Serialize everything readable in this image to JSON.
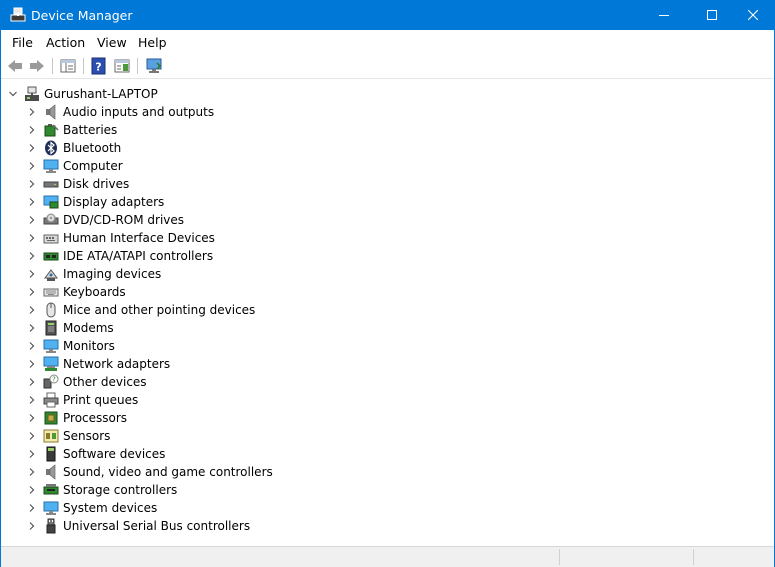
{
  "window": {
    "title": "Device Manager"
  },
  "menu": [
    {
      "label": "File",
      "name": "menu-file"
    },
    {
      "label": "Action",
      "name": "menu-action"
    },
    {
      "label": "View",
      "name": "menu-view"
    },
    {
      "label": "Help",
      "name": "menu-help"
    }
  ],
  "toolbar": [
    {
      "name": "back-button",
      "icon": "back-arrow-icon"
    },
    {
      "name": "forward-button",
      "icon": "forward-arrow-icon"
    },
    {
      "name": "show-hide-console-tree-button",
      "icon": "console-tree-icon"
    },
    {
      "name": "help-button",
      "icon": "help-icon"
    },
    {
      "name": "properties-button",
      "icon": "properties-pane-icon"
    },
    {
      "name": "scan-hardware-changes-button",
      "icon": "monitor-scan-icon"
    }
  ],
  "tree": {
    "root": {
      "label": "Gurushant-LAPTOP",
      "expanded": true,
      "icon": "computer-tree-icon"
    },
    "categories": [
      {
        "label": "Audio inputs and outputs",
        "icon": "speaker-icon"
      },
      {
        "label": "Batteries",
        "icon": "battery-icon"
      },
      {
        "label": "Bluetooth",
        "icon": "bluetooth-icon"
      },
      {
        "label": "Computer",
        "icon": "computer-icon"
      },
      {
        "label": "Disk drives",
        "icon": "disk-drive-icon"
      },
      {
        "label": "Display adapters",
        "icon": "display-adapter-icon"
      },
      {
        "label": "DVD/CD-ROM drives",
        "icon": "dvd-drive-icon"
      },
      {
        "label": "Human Interface Devices",
        "icon": "hid-icon"
      },
      {
        "label": "IDE ATA/ATAPI controllers",
        "icon": "ide-controller-icon"
      },
      {
        "label": "Imaging devices",
        "icon": "camera-icon"
      },
      {
        "label": "Keyboards",
        "icon": "keyboard-icon"
      },
      {
        "label": "Mice and other pointing devices",
        "icon": "mouse-icon"
      },
      {
        "label": "Modems",
        "icon": "modem-icon"
      },
      {
        "label": "Monitors",
        "icon": "monitor-icon"
      },
      {
        "label": "Network adapters",
        "icon": "network-adapter-icon"
      },
      {
        "label": "Other devices",
        "icon": "unknown-device-icon"
      },
      {
        "label": "Print queues",
        "icon": "printer-icon"
      },
      {
        "label": "Processors",
        "icon": "processor-icon"
      },
      {
        "label": "Sensors",
        "icon": "sensor-icon"
      },
      {
        "label": "Software devices",
        "icon": "software-device-icon"
      },
      {
        "label": "Sound, video and game controllers",
        "icon": "sound-controller-icon"
      },
      {
        "label": "Storage controllers",
        "icon": "storage-controller-icon"
      },
      {
        "label": "System devices",
        "icon": "system-device-icon"
      },
      {
        "label": "Universal Serial Bus controllers",
        "icon": "usb-icon"
      }
    ]
  },
  "colors": {
    "titlebar": "#0078d7",
    "accent": "#0078d7"
  }
}
